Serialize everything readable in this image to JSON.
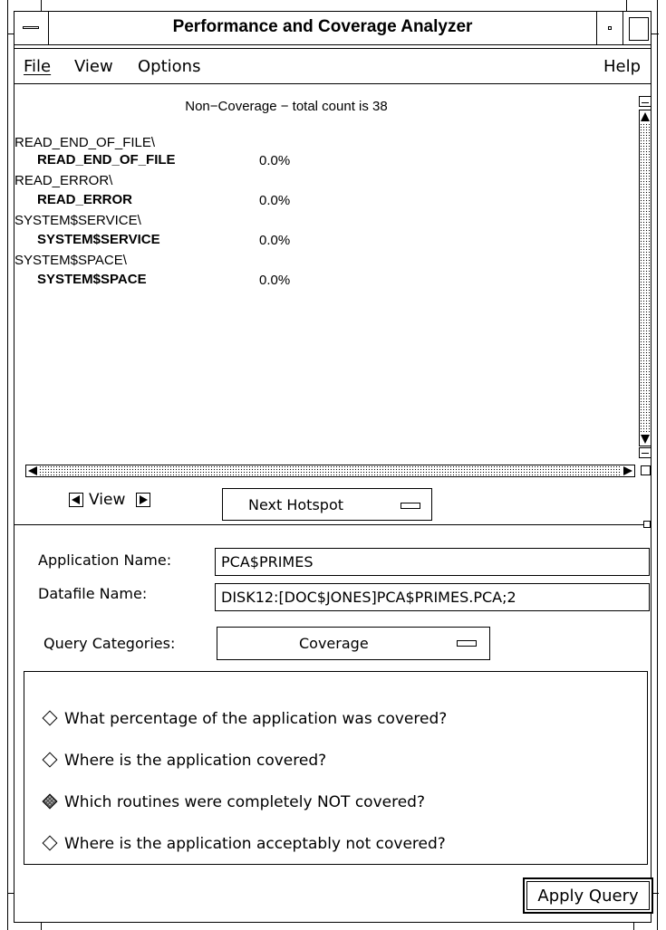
{
  "window": {
    "title": "Performance and Coverage Analyzer"
  },
  "menubar": {
    "file": "File",
    "view": "View",
    "options": "Options",
    "help": "Help"
  },
  "output": {
    "title": "Non−Coverage − total count is 38",
    "routines": [
      {
        "module": "READ_END_OF_FILE\\",
        "routine": "READ_END_OF_FILE",
        "percent": "0.0%"
      },
      {
        "module": "READ_ERROR\\",
        "routine": "READ_ERROR",
        "percent": "0.0%"
      },
      {
        "module": "SYSTEM$SERVICE\\",
        "routine": "SYSTEM$SERVICE",
        "percent": "0.0%"
      },
      {
        "module": "SYSTEM$SPACE\\",
        "routine": "SYSTEM$SPACE",
        "percent": "0.0%"
      }
    ]
  },
  "view_controls": {
    "view_label": "View",
    "next_hotspot": "Next Hotspot"
  },
  "form": {
    "application_name_label": "Application Name:",
    "application_name_value": "PCA$PRIMES",
    "datafile_name_label": "Datafile Name:",
    "datafile_name_value": "DISK12:[DOC$JONES]PCA$PRIMES.PCA;2",
    "query_categories_label": "Query Categories:",
    "query_categories_value": "Coverage"
  },
  "queries": [
    {
      "text": "What percentage of the application was covered?",
      "selected": false
    },
    {
      "text": "Where is the application covered?",
      "selected": false
    },
    {
      "text": "Which routines were completely NOT covered?",
      "selected": true
    },
    {
      "text": "Where is the application acceptably not covered?",
      "selected": false
    }
  ],
  "apply_button": "Apply Query"
}
